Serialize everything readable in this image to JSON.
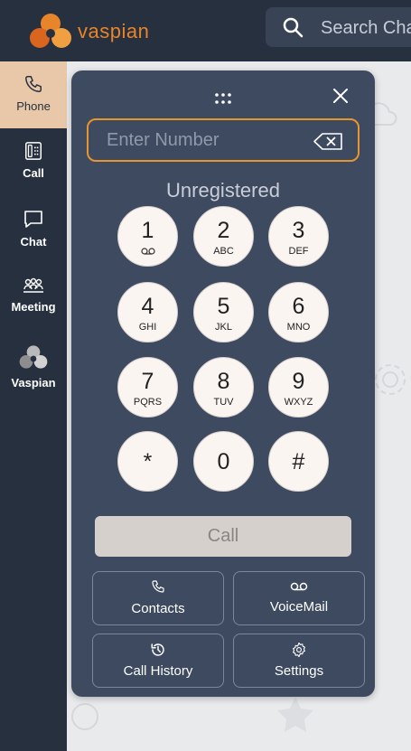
{
  "app": {
    "brand": "vaspian",
    "search_placeholder": "Search Chat"
  },
  "sidebar": {
    "items": [
      {
        "label": "Phone",
        "icon": "phone-icon",
        "active": true
      },
      {
        "label": "Call",
        "icon": "desk-phone-icon",
        "active": false
      },
      {
        "label": "Chat",
        "icon": "chat-bubble-icon",
        "active": false
      },
      {
        "label": "Meeting",
        "icon": "meeting-group-icon",
        "active": false
      },
      {
        "label": "Vaspian",
        "icon": "vaspian-logo-icon",
        "active": false
      }
    ]
  },
  "dialer": {
    "input_placeholder": "Enter Number",
    "input_value": "",
    "status": "Unregistered",
    "keys": [
      {
        "digit": "1",
        "sub": "",
        "sub_icon": "voicemail-icon"
      },
      {
        "digit": "2",
        "sub": "ABC"
      },
      {
        "digit": "3",
        "sub": "DEF"
      },
      {
        "digit": "4",
        "sub": "GHI"
      },
      {
        "digit": "5",
        "sub": "JKL"
      },
      {
        "digit": "6",
        "sub": "MNO"
      },
      {
        "digit": "7",
        "sub": "PQRS"
      },
      {
        "digit": "8",
        "sub": "TUV"
      },
      {
        "digit": "9",
        "sub": "WXYZ"
      },
      {
        "digit": "*",
        "sub": ""
      },
      {
        "digit": "0",
        "sub": ""
      },
      {
        "digit": "#",
        "sub": ""
      }
    ],
    "call_label": "Call",
    "actions": [
      {
        "label": "Contacts",
        "icon": "phone-icon"
      },
      {
        "label": "VoiceMail",
        "icon": "voicemail-icon"
      },
      {
        "label": "Call History",
        "icon": "history-icon"
      },
      {
        "label": "Settings",
        "icon": "gear-icon"
      }
    ]
  },
  "colors": {
    "topbar": "#26303f",
    "sidebar": "#26303f",
    "active_nav": "#e8c8a8",
    "panel": "#3d4a60",
    "accent": "#e8952e",
    "key_bg": "#fbf5f2",
    "call_disabled": "#d6d0cd"
  }
}
